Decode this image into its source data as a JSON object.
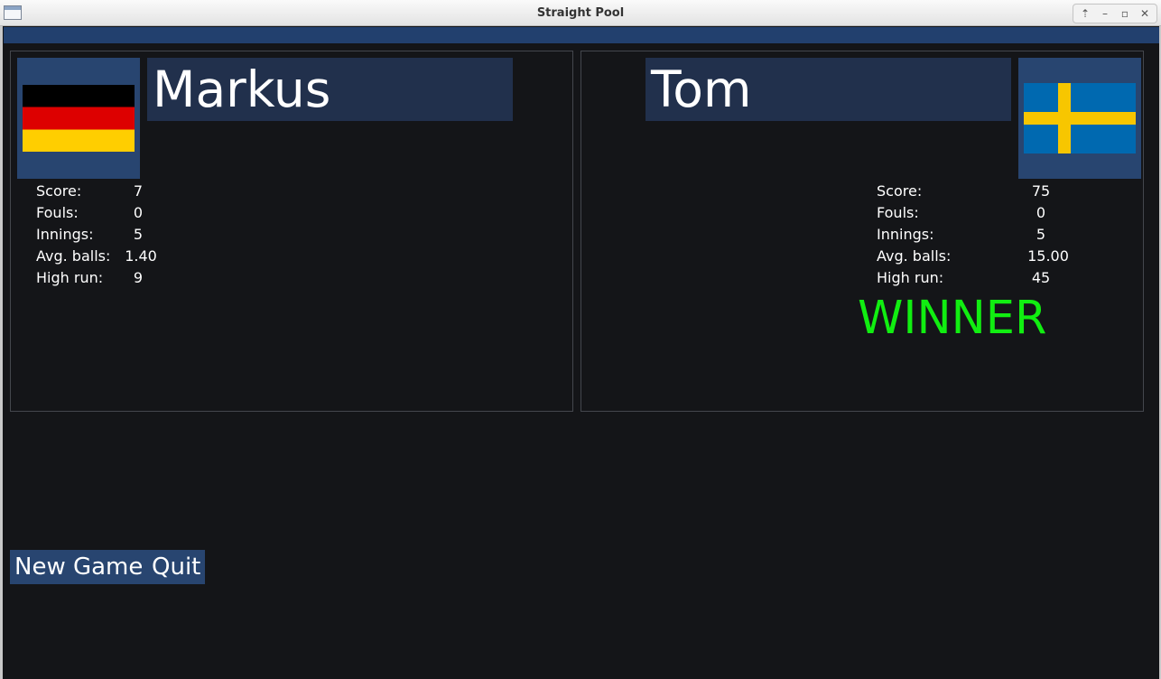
{
  "window": {
    "title": "Straight Pool"
  },
  "stat_labels": {
    "score": "Score:",
    "fouls": "Fouls:",
    "innings": "Innings:",
    "avg_balls": "Avg. balls:",
    "high_run": "High run:"
  },
  "players": [
    {
      "name": "Markus",
      "flag": "germany-flag",
      "stats": {
        "score": "7",
        "fouls": "0",
        "innings": "5",
        "avg_balls": "1.40",
        "high_run": "9"
      },
      "winner_text": ""
    },
    {
      "name": "Tom",
      "flag": "sweden-flag",
      "stats": {
        "score": "75",
        "fouls": "0",
        "innings": "5",
        "avg_balls": "15.00",
        "high_run": "45"
      },
      "winner_text": "WINNER"
    }
  ],
  "buttons": {
    "new_game": "New Game",
    "quit": "Quit"
  },
  "colors": {
    "background": "#141518",
    "accent_bar": "#22406e",
    "name_box": "#21304c",
    "button": "#284570",
    "winner": "#11ee11"
  }
}
